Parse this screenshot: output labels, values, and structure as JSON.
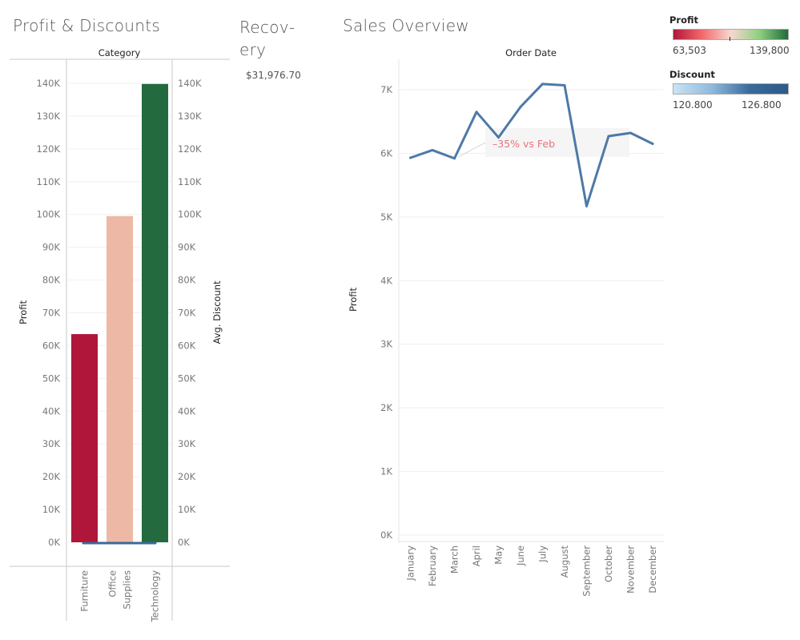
{
  "titles": {
    "left": "Profit & Discounts",
    "mid": "Recov-\nery",
    "right": "Sales Overview"
  },
  "recovery": {
    "value": "$31,976.70"
  },
  "legends": {
    "profit": {
      "title": "Profit",
      "min": "63,503",
      "max": "139,800",
      "colors": [
        "#b0163a",
        "#f26a6a",
        "#f7d7cf",
        "#8fd07f",
        "#1f6b3b"
      ]
    },
    "discount": {
      "title": "Discount",
      "min": "120.800",
      "max": "126.800",
      "colors": [
        "#c9e4f7",
        "#8fb9dc",
        "#3a6a99",
        "#2d5a87"
      ]
    }
  },
  "chart_data": [
    {
      "type": "bar",
      "header": "Category",
      "ylabel": "Profit",
      "y2label": "Avg. Discount",
      "categories": [
        "Furniture",
        "Office\nSupplies",
        "Technology"
      ],
      "values": [
        63503,
        99500,
        139800
      ],
      "bar_colors": [
        "#b0163a",
        "#edb9a6",
        "#236b3e"
      ],
      "ylim": [
        0,
        140000
      ],
      "ticks": [
        "0K",
        "10K",
        "20K",
        "30K",
        "40K",
        "50K",
        "60K",
        "70K",
        "80K",
        "90K",
        "100K",
        "110K",
        "120K",
        "130K",
        "140K"
      ],
      "discount_line_color": "#3a6a99"
    },
    {
      "type": "line",
      "header": "Order Date",
      "ylabel": "Profit",
      "x": [
        "January",
        "February",
        "March",
        "April",
        "May",
        "June",
        "July",
        "August",
        "September",
        "October",
        "November",
        "December"
      ],
      "values": [
        5930,
        6050,
        5920,
        6650,
        6250,
        6730,
        7090,
        7070,
        5170,
        6270,
        6320,
        6150
      ],
      "ylim": [
        0,
        7000
      ],
      "ticks": [
        "0K",
        "1K",
        "2K",
        "3K",
        "4K",
        "5K",
        "6K",
        "7K"
      ],
      "line_color": "#4e79a7",
      "annotation": {
        "text": "–35% vs Feb",
        "color": "#e8737c",
        "anchor_month_index": 2
      }
    }
  ]
}
